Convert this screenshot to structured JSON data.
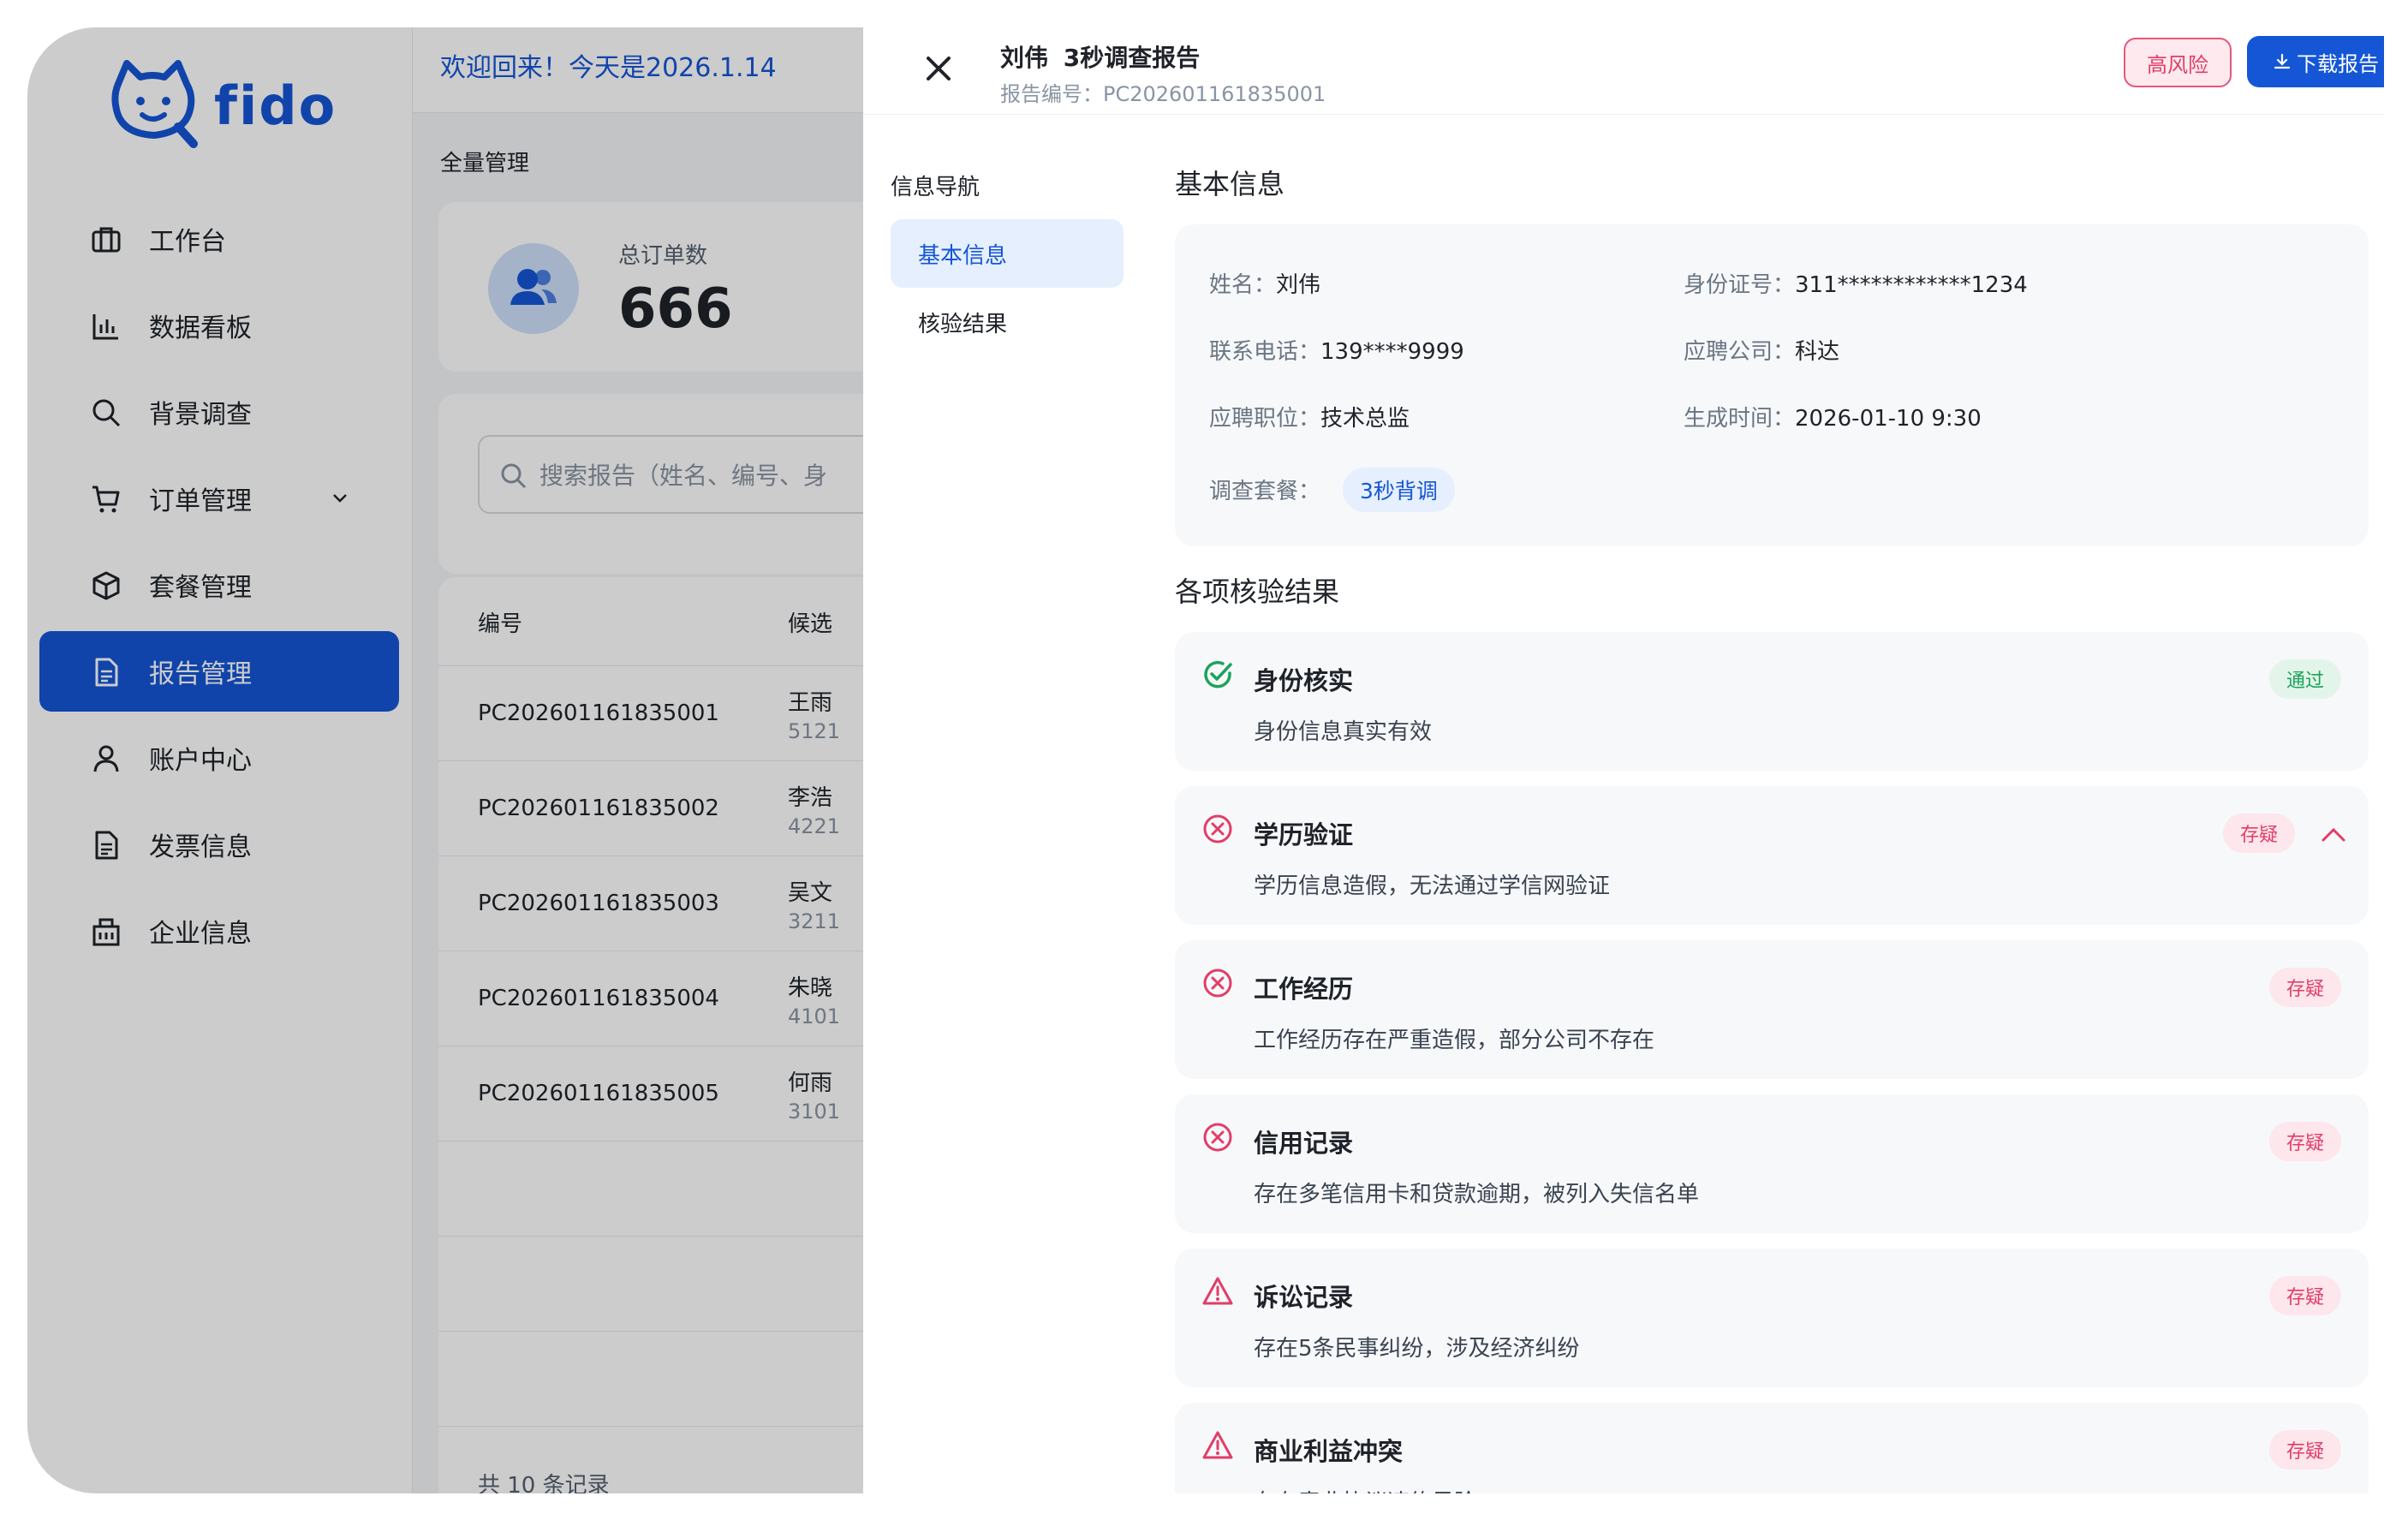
{
  "brand": {
    "name": "fido",
    "color": "#1456d6"
  },
  "sidebar": {
    "items": [
      {
        "label": "工作台",
        "icon": "briefcase-icon"
      },
      {
        "label": "数据看板",
        "icon": "bar-chart-icon"
      },
      {
        "label": "背景调查",
        "icon": "search-icon"
      },
      {
        "label": "订单管理",
        "icon": "cart-icon"
      },
      {
        "label": "套餐管理",
        "icon": "package-icon"
      },
      {
        "label": "报告管理",
        "icon": "document-icon"
      },
      {
        "label": "账户中心",
        "icon": "user-icon"
      },
      {
        "label": "发票信息",
        "icon": "invoice-icon"
      },
      {
        "label": "企业信息",
        "icon": "building-icon"
      }
    ],
    "active_index": 5
  },
  "main": {
    "welcome": "欢迎回来！今天是2026.1.14",
    "breadcrumb": "全量管理",
    "stat": {
      "label": "总订单数",
      "value": "666"
    },
    "search_placeholder": "搜索报告（姓名、编号、身",
    "table": {
      "headers": [
        "编号",
        "候选"
      ],
      "rows": [
        {
          "id": "PC202601161835001",
          "name": "王雨",
          "sub": "5121"
        },
        {
          "id": "PC202601161835002",
          "name": "李浩",
          "sub": "4221"
        },
        {
          "id": "PC202601161835003",
          "name": "吴文",
          "sub": "3211"
        },
        {
          "id": "PC202601161835004",
          "name": "朱晓",
          "sub": "4101"
        },
        {
          "id": "PC202601161835005",
          "name": "何雨",
          "sub": "3101"
        }
      ],
      "footer": "共 10 条记录"
    }
  },
  "drawer": {
    "title": "刘伟  3秒调查报告",
    "report_no": "报告编号：PC202601161835001",
    "risk_badge": "高风险",
    "download_label": "下载报告",
    "nav_title": "信息导航",
    "nav_items": [
      "基本信息",
      "核验结果"
    ],
    "basic_title": "基本信息",
    "basic": {
      "name": {
        "k": "姓名：",
        "v": "刘伟"
      },
      "id_card": {
        "k": "身份证号：",
        "v": "311************1234"
      },
      "phone": {
        "k": "联系电话：",
        "v": "139****9999"
      },
      "company": {
        "k": "应聘公司：",
        "v": "科达"
      },
      "position": {
        "k": "应聘职位：",
        "v": "技术总监"
      },
      "created": {
        "k": "生成时间：",
        "v": "2026-01-10 9:30"
      },
      "package": {
        "k": "调查套餐：",
        "v": "3秒背调"
      }
    },
    "results_title": "各项核验结果",
    "results": [
      {
        "name": "身份核实",
        "desc": "身份信息真实有效",
        "status": "通过",
        "status_type": "pass",
        "icon": "check-circle-icon"
      },
      {
        "name": "学历验证",
        "desc": "学历信息造假，无法通过学信网验证",
        "status": "存疑",
        "status_type": "doubt",
        "icon": "x-circle-icon"
      },
      {
        "name": "工作经历",
        "desc": "工作经历存在严重造假，部分公司不存在",
        "status": "存疑",
        "status_type": "doubt",
        "icon": "x-circle-icon"
      },
      {
        "name": "信用记录",
        "desc": "存在多笔信用卡和贷款逾期，被列入失信名单",
        "status": "存疑",
        "status_type": "doubt",
        "icon": "x-circle-icon"
      },
      {
        "name": "诉讼记录",
        "desc": "存在5条民事纠纷，涉及经济纠纷",
        "status": "存疑",
        "status_type": "doubt",
        "icon": "warning-icon"
      },
      {
        "name": "商业利益冲突",
        "desc": "存在竞业协议违约风险",
        "status": "存疑",
        "status_type": "doubt",
        "icon": "warning-icon"
      }
    ]
  }
}
